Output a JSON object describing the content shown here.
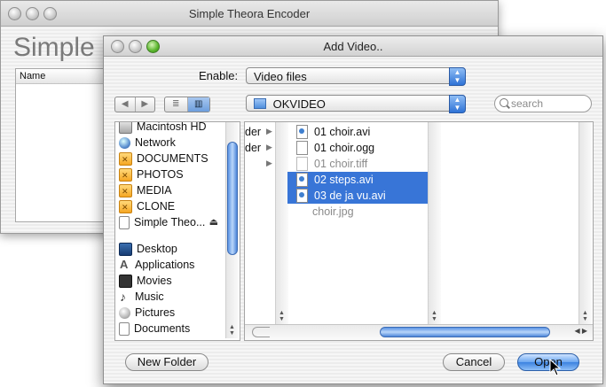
{
  "back_window": {
    "title": "Simple Theora Encoder",
    "big_title": "Simple",
    "table_header": "Name"
  },
  "dialog": {
    "title": "Add Video..",
    "enable_label": "Enable:",
    "enable_value": "Video files",
    "location_value": "OKVIDEO",
    "search_placeholder": "search",
    "sidebar": {
      "devices": [
        "Macintosh HD",
        "Network",
        "DOCUMENTS",
        "PHOTOS",
        "MEDIA",
        "CLONE",
        "Simple Theo..."
      ],
      "places": [
        "Desktop",
        "Applications",
        "Movies",
        "Music",
        "Pictures",
        "Documents"
      ]
    },
    "column1_items": [
      "der",
      "der",
      ""
    ],
    "files": [
      {
        "name": "01 choir.avi",
        "selected": false,
        "enabled": true,
        "icon": "video-file-icon"
      },
      {
        "name": "01 choir.ogg",
        "selected": false,
        "enabled": true,
        "icon": "file-icon"
      },
      {
        "name": "01 choir.tiff",
        "selected": false,
        "enabled": false,
        "icon": "file-icon"
      },
      {
        "name": "02 steps.avi",
        "selected": true,
        "enabled": true,
        "icon": "video-file-icon"
      },
      {
        "name": "03 de ja vu.avi",
        "selected": true,
        "enabled": true,
        "icon": "video-file-icon"
      },
      {
        "name": "choir.jpg",
        "selected": false,
        "enabled": false,
        "icon": "none"
      }
    ],
    "buttons": {
      "new_folder": "New Folder",
      "cancel": "Cancel",
      "open": "Open"
    }
  },
  "colors": {
    "selection": "#3875d7",
    "accent_blue": "#3b82e0"
  }
}
